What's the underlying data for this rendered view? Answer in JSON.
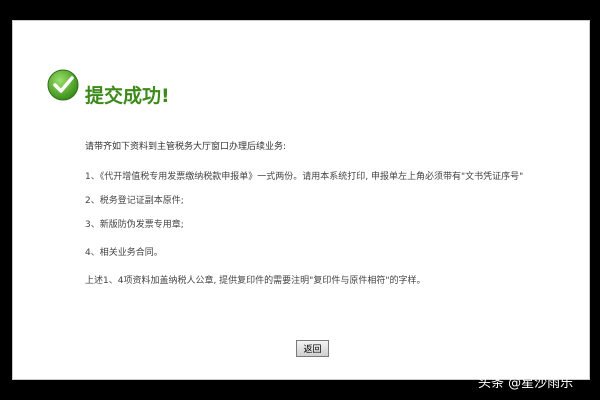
{
  "header": {
    "title": "提交成功!",
    "icon": "check-circle-icon",
    "accent_color": "#3d8a1a"
  },
  "content": {
    "intro": "请带齐如下资料到主管税务大厅窗口办理后续业务:",
    "items": [
      "1、《代开增值税专用发票缴纳税款申报单》一式两份。请用本系统打印, 申报单左上角必须带有\"文书凭证序号\"",
      "2、税务登记证副本原件;",
      "3、新版防伪发票专用章;",
      "4、相关业务合同。"
    ],
    "footnote": "上述1、4项资料加盖纳税人公章, 提供复印件的需要注明\"复印件与原件相符\"的字样。"
  },
  "actions": {
    "return_label": "返回"
  },
  "watermark": "头条 @星沙雨乐"
}
